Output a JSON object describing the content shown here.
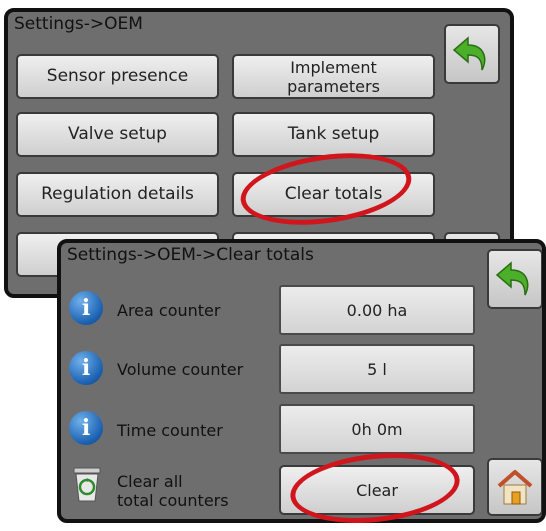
{
  "back_screen": {
    "title": "Settings->OEM",
    "buttons": {
      "sensor_presence": "Sensor presence",
      "implement_parameters_line1": "Implement",
      "implement_parameters_line2": "parameters",
      "valve_setup": "Valve setup",
      "tank_setup": "Tank setup",
      "regulation_details": "Regulation details",
      "clear_totals": "Clear totals"
    },
    "back_icon": "back-arrow-icon"
  },
  "front_screen": {
    "title": "Settings->OEM->Clear totals",
    "rows": [
      {
        "label": "Area counter",
        "value": "0.00 ha",
        "icon": "info-icon"
      },
      {
        "label": "Volume counter",
        "value": "5 l",
        "icon": "info-icon"
      },
      {
        "label": "Time counter",
        "value": "0h 0m",
        "icon": "info-icon"
      }
    ],
    "clear_label_line1": "Clear all",
    "clear_label_line2": "total counters",
    "clear_button": "Clear",
    "clear_icon": "recycle-bin-icon",
    "back_icon": "back-arrow-icon",
    "home_icon": "home-icon"
  },
  "colors": {
    "highlight": "#d0161c",
    "screen_bg": "#6e6e6e",
    "info_blue": "#1a5fb0",
    "arrow_green": "#4caf2a"
  }
}
